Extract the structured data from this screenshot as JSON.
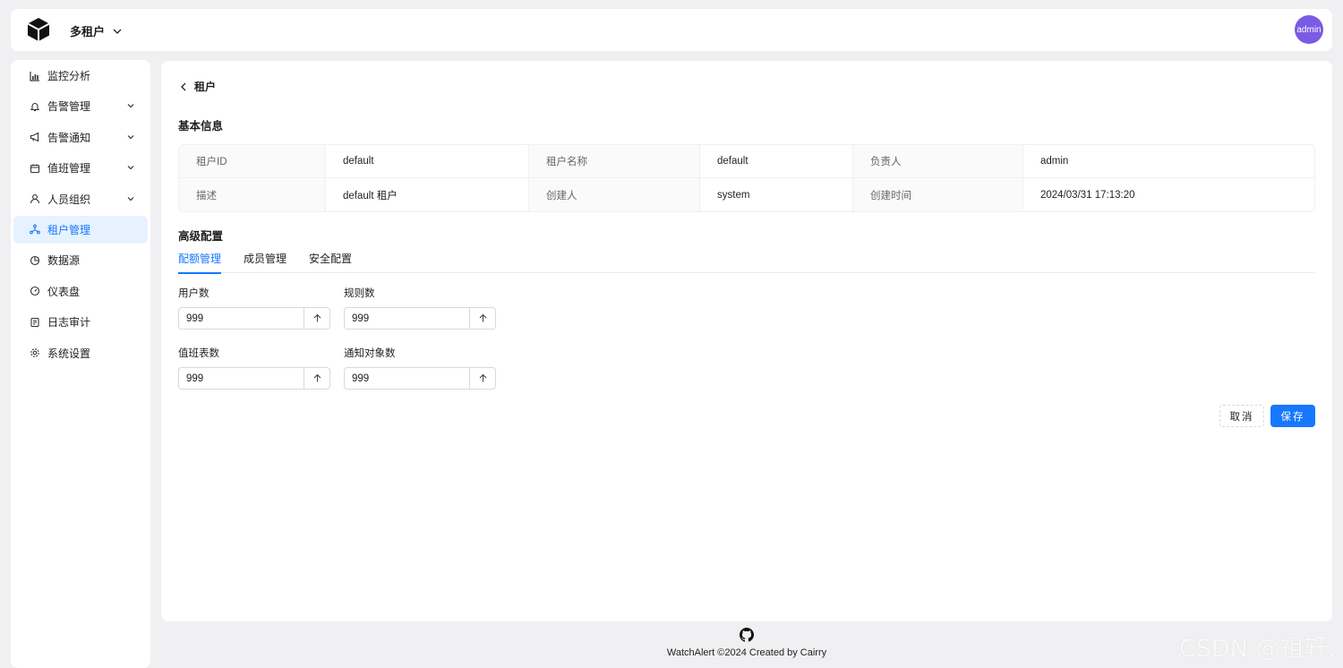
{
  "header": {
    "tenant_switch_label": "多租户",
    "avatar_text": "admin"
  },
  "sidebar": {
    "items": [
      {
        "label": "监控分析",
        "icon": "chart-icon"
      },
      {
        "label": "告警管理",
        "icon": "bell-icon"
      },
      {
        "label": "告警通知",
        "icon": "megaphone-icon"
      },
      {
        "label": "值班管理",
        "icon": "calendar-icon"
      },
      {
        "label": "人员组织",
        "icon": "user-icon"
      },
      {
        "label": "租户管理",
        "icon": "cluster-icon"
      },
      {
        "label": "数据源",
        "icon": "pie-icon"
      },
      {
        "label": "仪表盘",
        "icon": "dashboard-icon"
      },
      {
        "label": "日志审计",
        "icon": "audit-icon"
      },
      {
        "label": "系统设置",
        "icon": "gear-icon"
      }
    ]
  },
  "page": {
    "back_label": "租户",
    "basic_title": "基本信息",
    "advanced_title": "高级配置"
  },
  "basic_info": {
    "tenant_id_label": "租户ID",
    "tenant_id": "default",
    "tenant_name_label": "租户名称",
    "tenant_name": "default",
    "owner_label": "负责人",
    "owner": "admin",
    "desc_label": "描述",
    "desc": "default 租户",
    "creator_label": "创建人",
    "creator": "system",
    "created_at_label": "创建时间",
    "created_at": "2024/03/31 17:13:20"
  },
  "tabs": [
    "配额管理",
    "成员管理",
    "安全配置"
  ],
  "quota": {
    "users_label": "用户数",
    "users": "999",
    "rules_label": "规则数",
    "rules": "999",
    "duty_label": "值班表数",
    "duty": "999",
    "notice_label": "通知对象数",
    "notice": "999"
  },
  "actions": {
    "cancel": "取消",
    "save": "保存"
  },
  "footer": {
    "text": "WatchAlert ©2024 Created by Cairry"
  },
  "watermark": "CSDN @祖轩.",
  "colors": {
    "accent": "#1677ff",
    "avatar": "#7b5be3",
    "active_bg": "#e6f2ff"
  }
}
